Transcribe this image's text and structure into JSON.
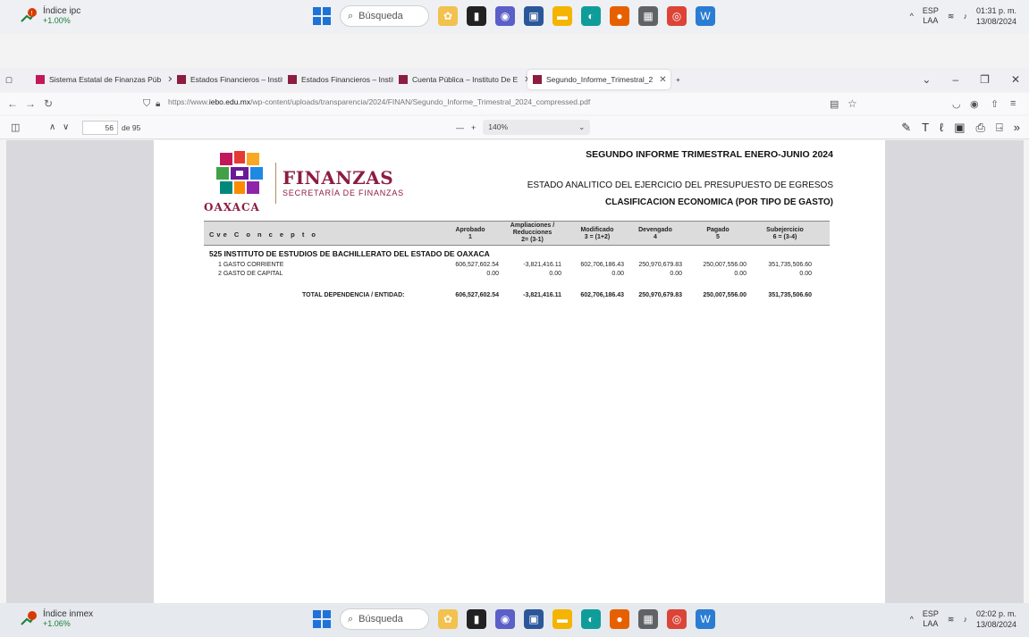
{
  "taskbar_top": {
    "widget_title": "Índice ipc",
    "widget_value": "+1.00%",
    "search_placeholder": "Búsqueda",
    "lang": "ESP",
    "lang_sub": "LAA",
    "time": "01:31 p. m.",
    "date": "13/08/2024"
  },
  "taskbar_bottom": {
    "widget_title": "Índice inmex",
    "widget_value": "+1.06%",
    "search_placeholder": "Búsqueda",
    "lang": "ESP",
    "lang_sub": "LAA",
    "time": "02:02 p. m.",
    "date": "13/08/2024"
  },
  "tabs": [
    {
      "label": "Sistema Estatal de Finanzas Púb",
      "active": false
    },
    {
      "label": "Estados Financieros – Instituto I",
      "active": false
    },
    {
      "label": "Estados Financieros – Instituto I",
      "active": false
    },
    {
      "label": "Cuenta Pública – Instituto De E",
      "active": false
    },
    {
      "label": "Segundo_Informe_Trimestral_2",
      "active": true
    }
  ],
  "url": {
    "prefix": "https://www.",
    "host": "iebo.edu.mx",
    "path": "/wp-content/uploads/transparencia/2024/FINAN/Segundo_Informe_Trimestral_2024_compressed.pdf"
  },
  "pdf_toolbar": {
    "page_number": "56",
    "page_total": "de 95",
    "zoom": "140%"
  },
  "document": {
    "logo_main": "FINANZAS",
    "logo_sub": "SECRETARÍA DE FINANZAS",
    "logo_state": "OAXACA",
    "title": "SEGUNDO INFORME TRIMESTRAL ENERO-JUNIO 2024",
    "subtitle1": "ESTADO ANALITICO DEL EJERCICIO DEL PRESUPUESTO DE EGRESOS",
    "subtitle2": "CLASIFICACION ECONOMICA (POR TIPO DE GASTO)",
    "table_headers": {
      "concept": "Cve  C o n c e p t o",
      "aprobado": "Aprobado",
      "aprobado_n": "1",
      "ampliaciones": "Ampliaciones / Reducciones",
      "ampliaciones_n": "2= (3-1)",
      "modificado": "Modificado",
      "modificado_n": "3 = (1+2)",
      "devengado": "Devengado",
      "devengado_n": "4",
      "pagado": "Pagado",
      "pagado_n": "5",
      "subejercicio": "Subejercicio",
      "subejercicio_n": "6 = (3-4)"
    },
    "institution": "525   INSTITUTO DE ESTUDIOS DE BACHILLERATO DEL ESTADO DE OAXACA",
    "rows": [
      {
        "label": "1   GASTO CORRIENTE",
        "aprobado": "606,527,602.54",
        "ampliaciones": "-3,821,416.11",
        "modificado": "602,706,186.43",
        "devengado": "250,970,679.83",
        "pagado": "250,007,556.00",
        "subejercicio": "351,735,506.60"
      },
      {
        "label": "2   GASTO DE CAPITAL",
        "aprobado": "0.00",
        "ampliaciones": "0.00",
        "modificado": "0.00",
        "devengado": "0.00",
        "pagado": "0.00",
        "subejercicio": "0.00"
      }
    ],
    "total": {
      "label": "TOTAL DEPENDENCIA  / ENTIDAD:",
      "aprobado": "606,527,602.54",
      "ampliaciones": "-3,821,416.11",
      "modificado": "602,706,186.43",
      "devengado": "250,970,679.83",
      "pagado": "250,007,556.00",
      "subejercicio": "351,735,506.60"
    }
  }
}
